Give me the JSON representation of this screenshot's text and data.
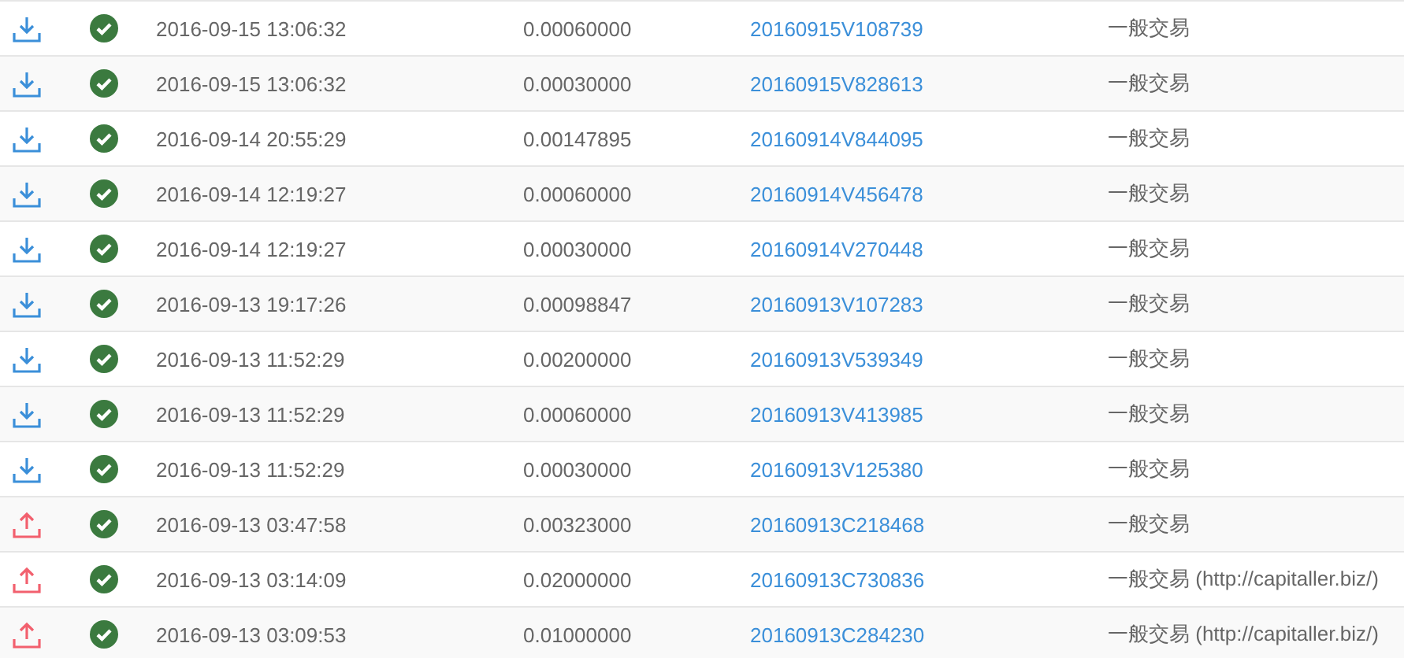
{
  "transactions": [
    {
      "kind": "incoming",
      "confirmed": true,
      "time": "2016-09-15 13:06:32",
      "amount": "0.00060000",
      "txid": "20160915V108739",
      "type": "一般交易"
    },
    {
      "kind": "incoming",
      "confirmed": true,
      "time": "2016-09-15 13:06:32",
      "amount": "0.00030000",
      "txid": "20160915V828613",
      "type": "一般交易"
    },
    {
      "kind": "incoming",
      "confirmed": true,
      "time": "2016-09-14 20:55:29",
      "amount": "0.00147895",
      "txid": "20160914V844095",
      "type": "一般交易"
    },
    {
      "kind": "incoming",
      "confirmed": true,
      "time": "2016-09-14 12:19:27",
      "amount": "0.00060000",
      "txid": "20160914V456478",
      "type": "一般交易"
    },
    {
      "kind": "incoming",
      "confirmed": true,
      "time": "2016-09-14 12:19:27",
      "amount": "0.00030000",
      "txid": "20160914V270448",
      "type": "一般交易"
    },
    {
      "kind": "incoming",
      "confirmed": true,
      "time": "2016-09-13 19:17:26",
      "amount": "0.00098847",
      "txid": "20160913V107283",
      "type": "一般交易"
    },
    {
      "kind": "incoming",
      "confirmed": true,
      "time": "2016-09-13 11:52:29",
      "amount": "0.00200000",
      "txid": "20160913V539349",
      "type": "一般交易"
    },
    {
      "kind": "incoming",
      "confirmed": true,
      "time": "2016-09-13 11:52:29",
      "amount": "0.00060000",
      "txid": "20160913V413985",
      "type": "一般交易"
    },
    {
      "kind": "incoming",
      "confirmed": true,
      "time": "2016-09-13 11:52:29",
      "amount": "0.00030000",
      "txid": "20160913V125380",
      "type": "一般交易"
    },
    {
      "kind": "outgoing",
      "confirmed": true,
      "time": "2016-09-13 03:47:58",
      "amount": "0.00323000",
      "txid": "20160913C218468",
      "type": "一般交易"
    },
    {
      "kind": "outgoing",
      "confirmed": true,
      "time": "2016-09-13 03:14:09",
      "amount": "0.02000000",
      "txid": "20160913C730836",
      "type": "一般交易 (http://capitaller.biz/)"
    },
    {
      "kind": "outgoing",
      "confirmed": true,
      "time": "2016-09-13 03:09:53",
      "amount": "0.01000000",
      "txid": "20160913C284230",
      "type": "一般交易 (http://capitaller.biz/)"
    }
  ]
}
